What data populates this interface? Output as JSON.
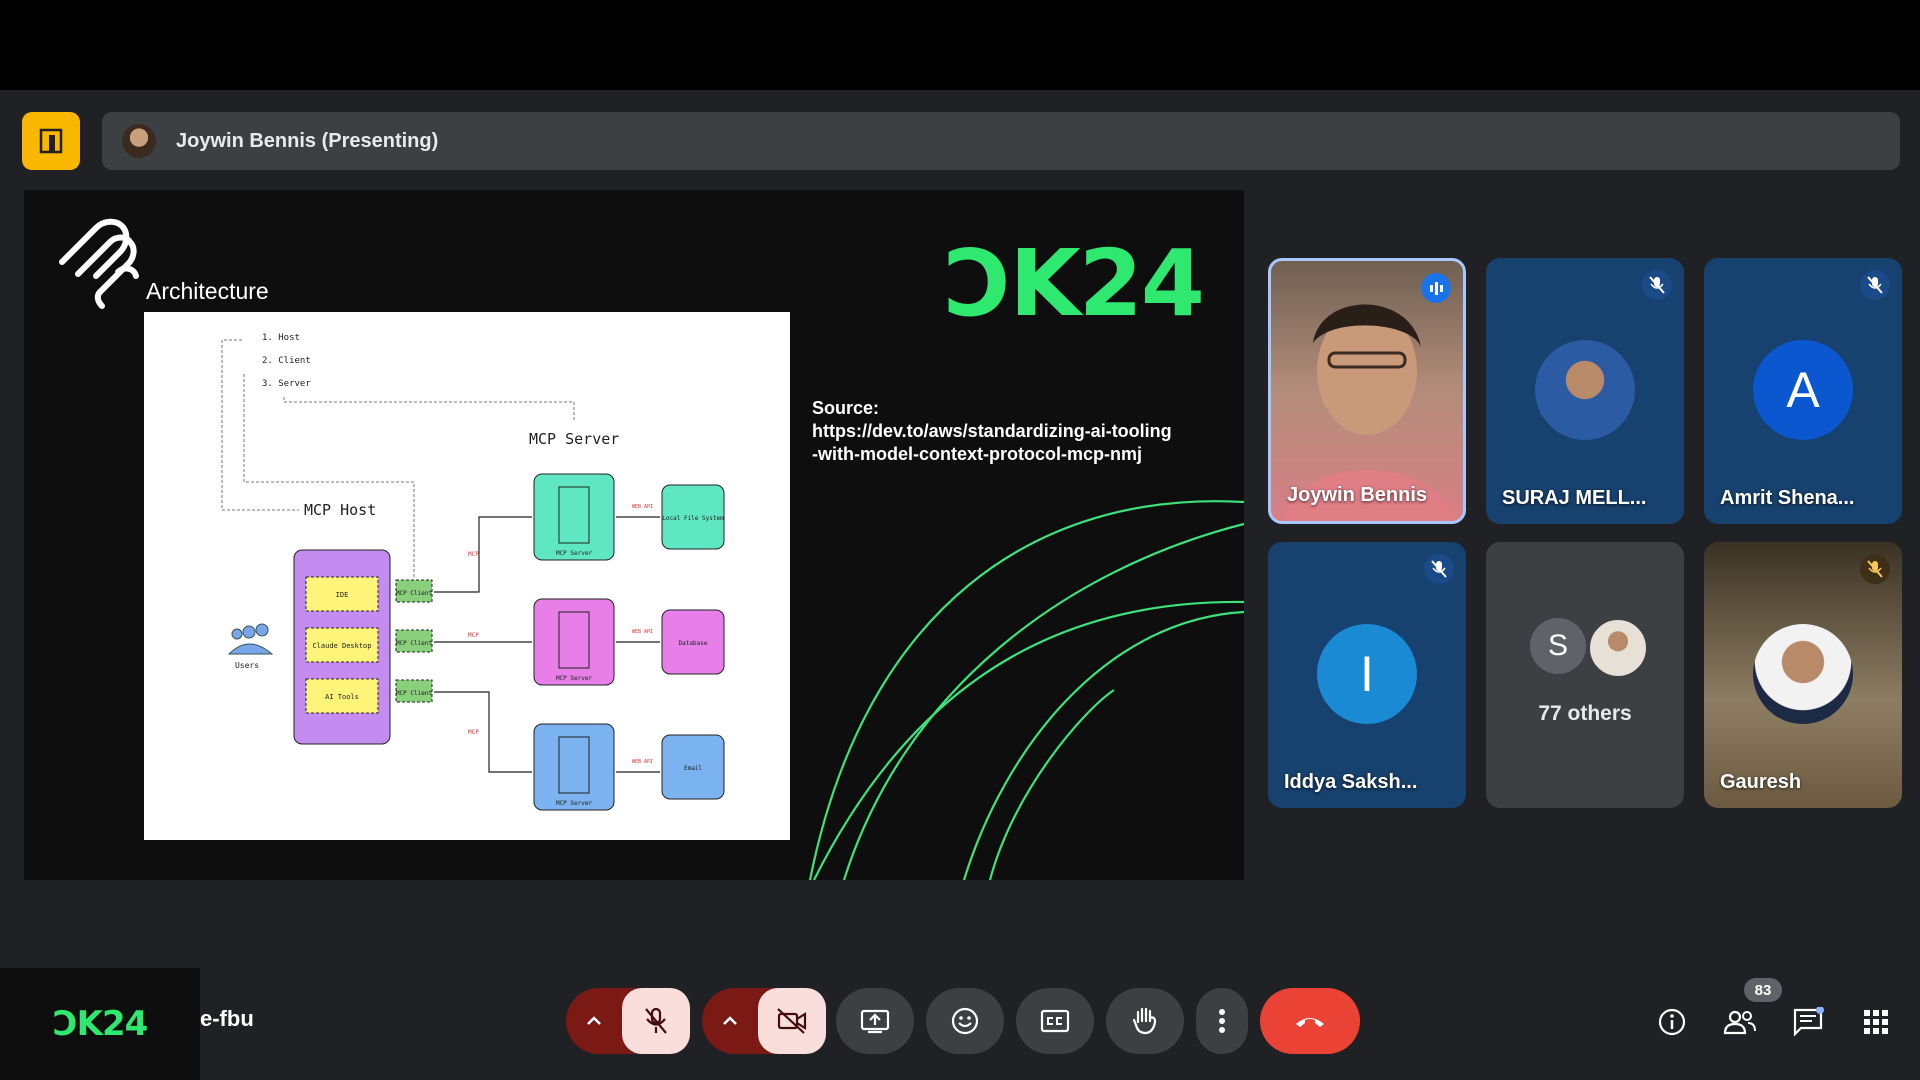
{
  "presenting": {
    "label": "Joywin Bennis (Presenting)"
  },
  "slide": {
    "title": "Architecture",
    "brand": "ƆK24",
    "source_label": "Source:",
    "source_url": "https://dev.to/aws/standardizing-ai-tooling-with-model-context-protocol-mcp-nmj",
    "diagram": {
      "list": [
        "1. Host",
        "2. Client",
        "3. Server"
      ],
      "server_heading": "MCP Server",
      "host_heading": "MCP Host",
      "host_items": [
        "IDE",
        "Claude Desktop",
        "AI Tools"
      ],
      "client_label": "MCP Client",
      "users_label": "Users",
      "mcp_label": "MCP",
      "web_api_label": "WEB API",
      "server_box_label": "MCP Server",
      "resources": [
        "Local File System",
        "Database",
        "Email"
      ]
    }
  },
  "participants": [
    {
      "name": "Joywin Bennis",
      "state": "speaking"
    },
    {
      "name": "SURAJ MELL...",
      "state": "muted"
    },
    {
      "name": "Amrit Shena...",
      "state": "muted",
      "initial": "A"
    },
    {
      "name": "Iddya Saksh...",
      "state": "muted",
      "initial": "I"
    },
    {
      "name": "77 others",
      "initial": "S"
    },
    {
      "name": "Gauresh",
      "state": "muted"
    }
  ],
  "bottom_bar": {
    "brand": "ƆK24",
    "meeting_code": "e-fbu",
    "participant_count": "83"
  },
  "colors": {
    "accent": "#2ee86f",
    "end_call": "#ea4335",
    "mic_off_bg": "#f9dedc"
  }
}
